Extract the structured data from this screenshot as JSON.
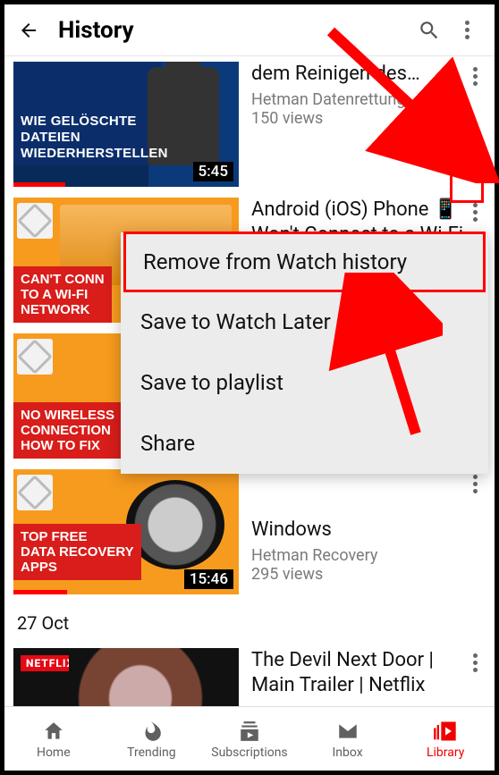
{
  "header": {
    "title": "History"
  },
  "videos": [
    {
      "title": "dem Reinigen des…",
      "channel": "Hetman Datenrettung",
      "views": "150 views",
      "duration": "5:45",
      "overlay": "WIE GELÖSCHTE\nDATEIEN\nWIEDERHERSTELLEN",
      "progress": 0.23
    },
    {
      "title": "Android (iOS) Phone 📱 Won't Connect to a Wi-Fi Network, …",
      "overlay": "CAN'T CONN\nTO A WI-FI\nNETWORK"
    },
    {
      "overlay": "NO WIRELESS\nCONNECTION\nHOW TO FIX"
    },
    {
      "title": "Windows",
      "channel": "Hetman Recovery",
      "views": "295 views",
      "duration": "15:46",
      "overlay": "TOP FREE\nDATA RECOVERY\nAPPS",
      "progress": 0.24
    },
    {
      "title": "The Devil Next Door | Main Trailer | Netflix"
    }
  ],
  "date_header": "27 Oct",
  "popup": {
    "remove": "Remove from Watch history",
    "watch_later": "Save to Watch Later",
    "playlist": "Save to playlist",
    "share": "Share"
  },
  "nav": {
    "home": "Home",
    "trending": "Trending",
    "subs": "Subscriptions",
    "inbox": "Inbox",
    "library": "Library"
  }
}
